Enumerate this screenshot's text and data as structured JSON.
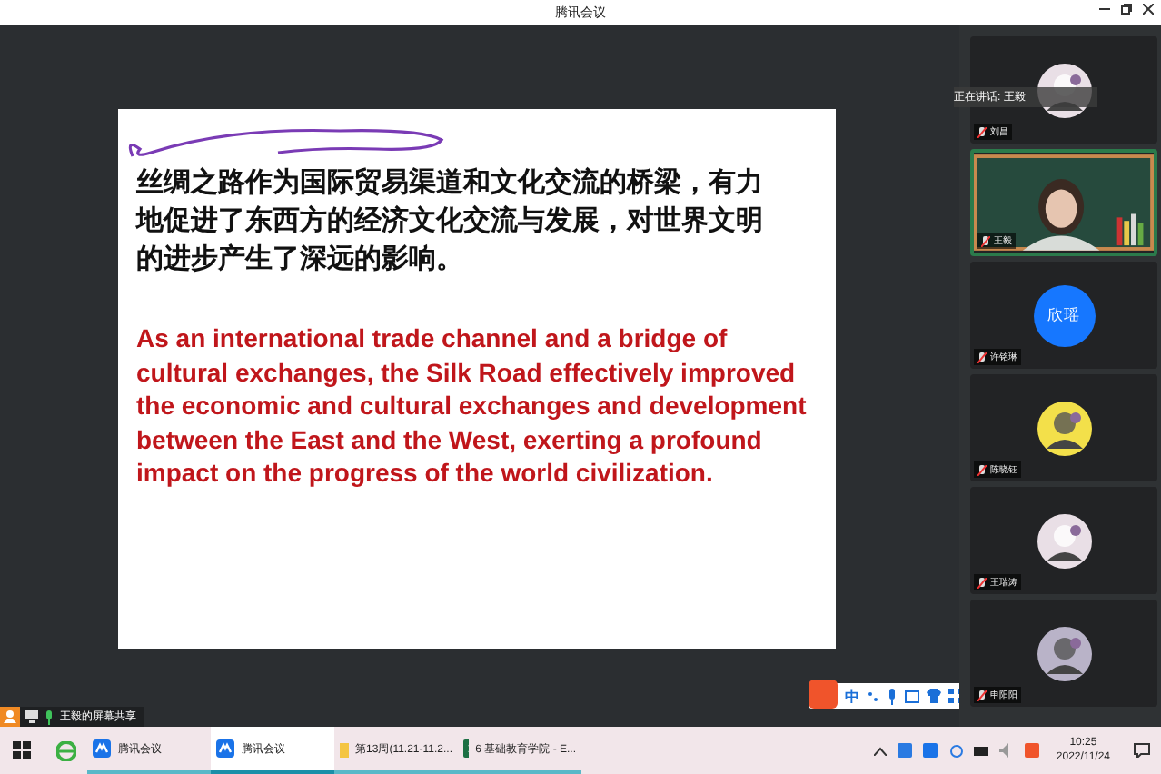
{
  "window": {
    "title": "腾讯会议"
  },
  "speaking": {
    "label": "正在讲话: 王毅"
  },
  "participants": [
    {
      "name": "刘昌",
      "kind": "avatar",
      "speaking": false
    },
    {
      "name": "王毅",
      "kind": "video",
      "speaking": true
    },
    {
      "name": "许铭琳",
      "kind": "initials",
      "initials": "欣瑶",
      "speaking": false
    },
    {
      "name": "陈晓钰",
      "kind": "avatar",
      "speaking": false
    },
    {
      "name": "王瑞涛",
      "kind": "avatar",
      "speaking": false
    },
    {
      "name": "申阳阳",
      "kind": "avatar",
      "speaking": false
    }
  ],
  "slide": {
    "chinese": "丝绸之路作为国际贸易渠道和文化交流的桥梁，有力地促进了东西方的经济文化交流与发展，对世界文明的进步产生了深远的影响。",
    "english": "As an international trade channel and a bridge of cultural exchanges, the Silk Road effectively improved the economic and cultural exchanges and development between the East and the West, exerting a profound impact on the progress of the world civilization."
  },
  "ime": {
    "mode": "中"
  },
  "share": {
    "label": "王毅的屏幕共享"
  },
  "taskbar": {
    "apps": [
      {
        "label": "腾讯会议",
        "kind": "meeting",
        "selected": false
      },
      {
        "label": "腾讯会议",
        "kind": "meeting",
        "selected": true
      },
      {
        "label": "第13周(11.21-11.2...",
        "kind": "folder",
        "selected": false
      },
      {
        "label": "6 基础教育学院 - E...",
        "kind": "excel",
        "selected": false
      }
    ],
    "time": "10:25",
    "date": "2022/11/24"
  }
}
